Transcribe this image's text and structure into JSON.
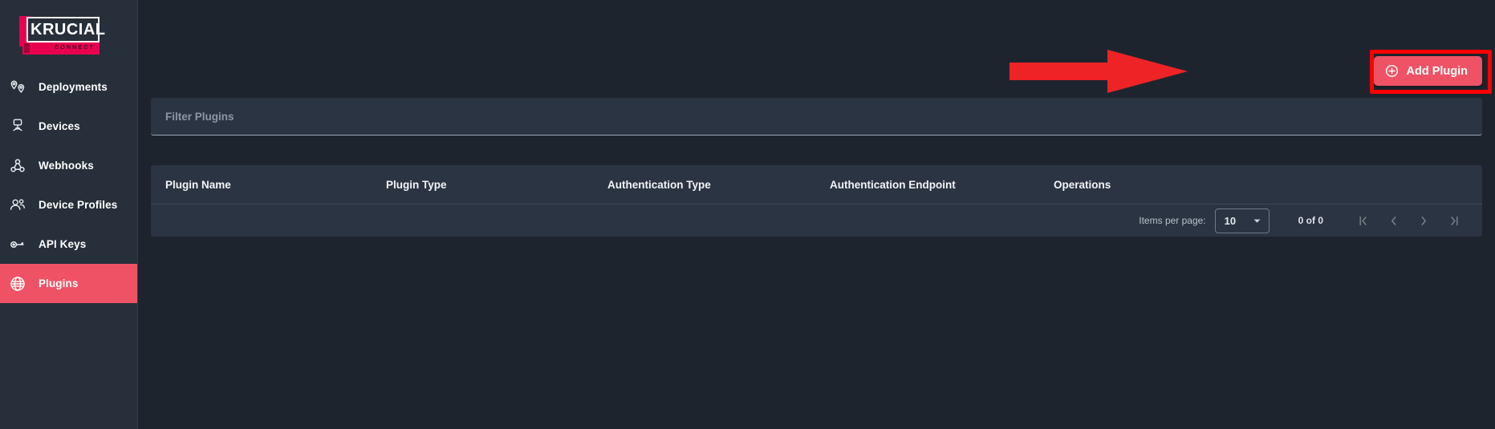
{
  "brand": {
    "logo_word": "KRUCIAL",
    "logo_sub": "CONNECT",
    "accent_color": "#f05265",
    "logo_band_color": "#e8004f"
  },
  "sidebar": {
    "items": [
      {
        "label": "Deployments",
        "icon": "location-pins-icon",
        "active": false
      },
      {
        "label": "Devices",
        "icon": "sensor-signal-icon",
        "active": false
      },
      {
        "label": "Webhooks",
        "icon": "webhook-icon",
        "active": false
      },
      {
        "label": "Device Profiles",
        "icon": "users-icon",
        "active": false
      },
      {
        "label": "API Keys",
        "icon": "key-icon",
        "active": false
      },
      {
        "label": "Plugins",
        "icon": "globe-icon",
        "active": true
      }
    ]
  },
  "toolbar": {
    "add_plugin_label": "Add Plugin",
    "add_plugin_icon": "plus-circle-icon"
  },
  "filter": {
    "title": "Filter Plugins"
  },
  "table": {
    "columns": [
      "Plugin Name",
      "Plugin Type",
      "Authentication Type",
      "Authentication Endpoint",
      "Operations"
    ],
    "rows": []
  },
  "paginator": {
    "items_per_page_label": "Items per page:",
    "items_per_page_value": "10",
    "range_label": "0 of 0",
    "first_page_icon": "first-page-icon",
    "prev_page_icon": "chevron-left-icon",
    "next_page_icon": "chevron-right-icon",
    "last_page_icon": "last-page-icon"
  },
  "annotations": {
    "highlight_color": "#fe0000",
    "arrow_target": "Add Plugin"
  }
}
